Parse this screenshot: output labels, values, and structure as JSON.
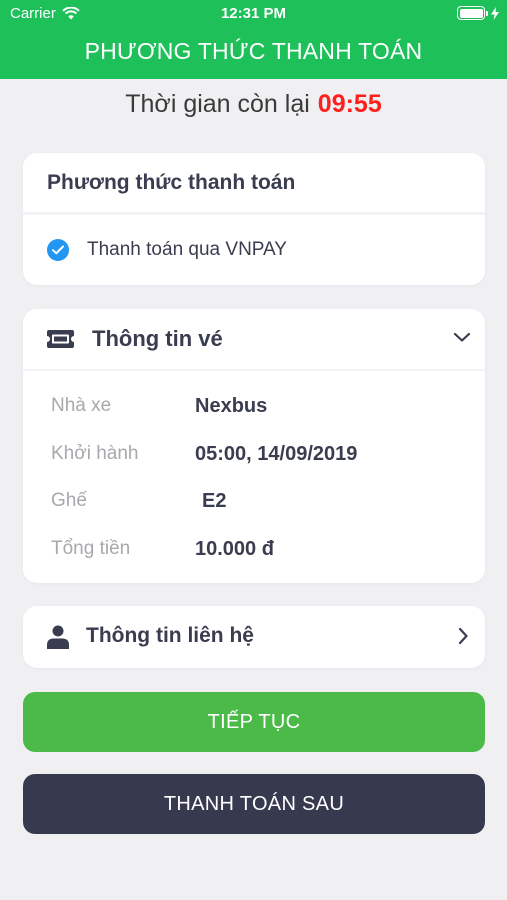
{
  "status_bar": {
    "carrier": "Carrier",
    "time": "12:31 PM"
  },
  "header": {
    "title": "PHƯƠNG THỨC THANH TOÁN"
  },
  "timer": {
    "label": "Thời gian còn lại",
    "value": "09:55"
  },
  "payment": {
    "title": "Phương thức thanh toán",
    "option": "Thanh toán qua VNPAY",
    "selected": true
  },
  "ticket": {
    "title": "Thông tin vé",
    "rows": [
      {
        "label": "Nhà xe",
        "value": "Nexbus"
      },
      {
        "label": "Khởi hành",
        "value": "05:00, 14/09/2019"
      },
      {
        "label": "Ghế",
        "value": "E2"
      },
      {
        "label": "Tổng tiền",
        "value": "10.000 đ"
      }
    ]
  },
  "contact": {
    "title": "Thông tin liên hệ"
  },
  "buttons": {
    "continue": "TIẾP TỤC",
    "pay_later": "THANH TOÁN SAU"
  },
  "colors": {
    "header_green": "#1ec05a",
    "countdown_red": "#ff1f1f",
    "check_blue": "#2196f3",
    "continue_green": "#4cba49",
    "pay_later_dark": "#373a4f"
  },
  "icons": {
    "wifi": "wifi-icon",
    "battery": "battery-icon",
    "charging": "bolt-icon",
    "check": "check-circle-icon",
    "ticket": "ticket-icon",
    "chevron_down": "chevron-down-icon",
    "user": "user-icon",
    "chevron_right": "chevron-right-icon"
  }
}
